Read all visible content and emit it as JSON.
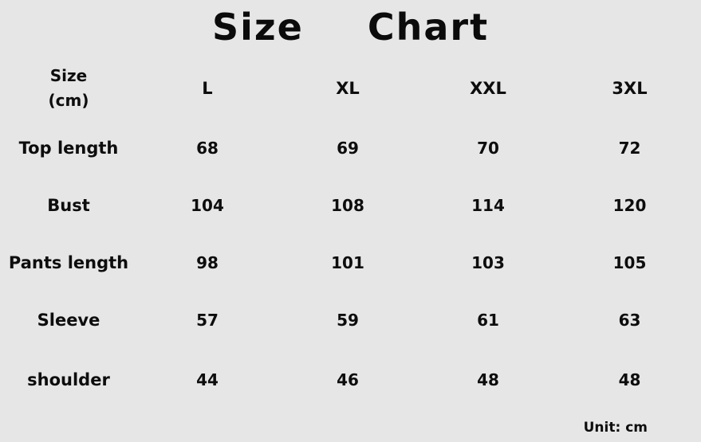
{
  "title": "Size  Chart",
  "table": {
    "corner_header": "Size\n(cm)",
    "size_columns": [
      "L",
      "XL",
      "XXL",
      "3XL"
    ],
    "rows": [
      {
        "label": "Top length",
        "values": [
          "68",
          "69",
          "70",
          "72"
        ]
      },
      {
        "label": "Bust",
        "values": [
          "104",
          "108",
          "114",
          "120"
        ]
      },
      {
        "label": "Pants length",
        "values": [
          "98",
          "101",
          "103",
          "105"
        ]
      },
      {
        "label": "Sleeve",
        "values": [
          "57",
          "59",
          "61",
          "63"
        ]
      },
      {
        "label": "shoulder",
        "values": [
          "44",
          "46",
          "48",
          "48"
        ]
      }
    ]
  },
  "footer": {
    "unit_note": "Unit: cm"
  },
  "colors": {
    "background": "#e6e6e6",
    "text": "#0d0d0d"
  },
  "chart_data": {
    "type": "table",
    "title": "Size  Chart",
    "unit": "cm",
    "row_header": "Size (cm)",
    "categories": [
      "L",
      "XL",
      "XXL",
      "3XL"
    ],
    "series": [
      {
        "name": "Top length",
        "values": [
          68,
          69,
          70,
          72
        ]
      },
      {
        "name": "Bust",
        "values": [
          104,
          108,
          114,
          120
        ]
      },
      {
        "name": "Pants length",
        "values": [
          98,
          101,
          103,
          105
        ]
      },
      {
        "name": "Sleeve",
        "values": [
          57,
          59,
          61,
          63
        ]
      },
      {
        "name": "shoulder",
        "values": [
          44,
          46,
          48,
          48
        ]
      }
    ]
  }
}
